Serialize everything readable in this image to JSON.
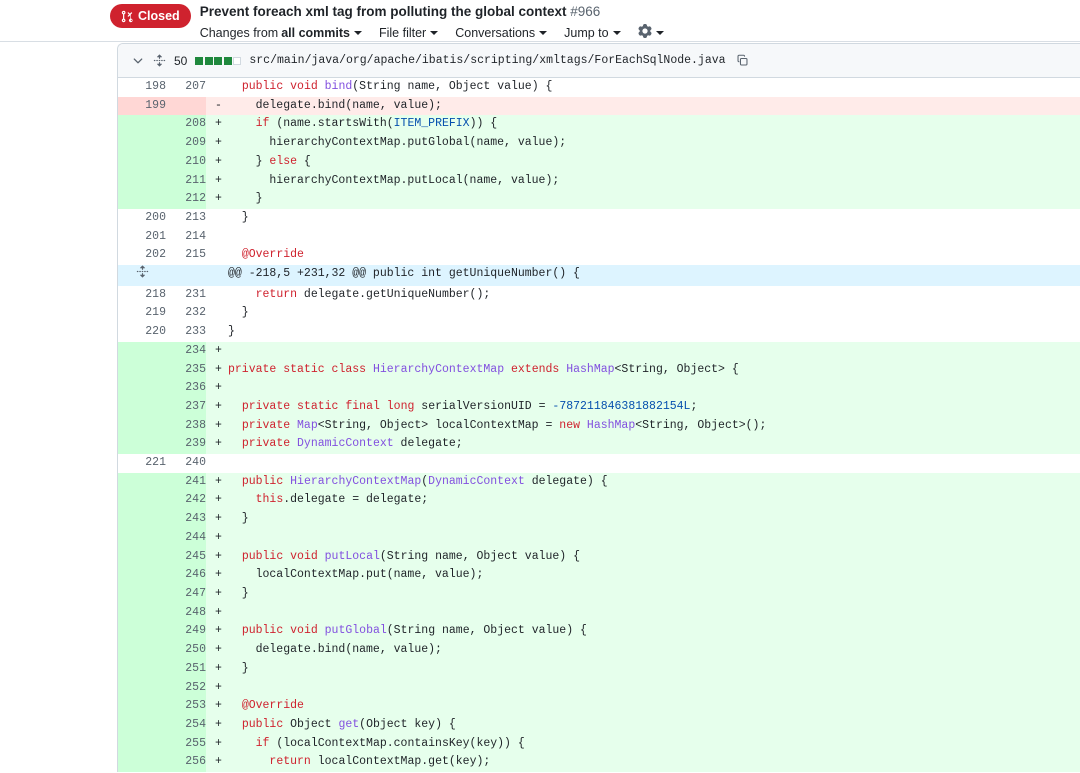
{
  "header": {
    "state_badge": {
      "label": "Closed",
      "icon": "pull-request-closed-icon",
      "color": "#cf222e"
    },
    "title": "Prevent foreach xml tag from polluting the global context",
    "number": "#966",
    "nav": [
      {
        "name": "changes-from",
        "prefix": "Changes from ",
        "strong": "all commits",
        "has_caret": true
      },
      {
        "name": "file-filter",
        "prefix": "",
        "strong": "File filter",
        "has_caret": true
      },
      {
        "name": "conversations",
        "prefix": "",
        "strong": "Conversations",
        "has_caret": true
      },
      {
        "name": "jump-to",
        "prefix": "",
        "strong": "Jump to",
        "has_caret": true
      }
    ],
    "settings_icon": "gear-icon"
  },
  "file": {
    "collapse_icon": "chevron-down-icon",
    "unfold_icon": "unfold-icon",
    "changes_count": "50",
    "diffstat": [
      "add",
      "add",
      "add",
      "add",
      "none"
    ],
    "path": "src/main/java/org/apache/ibatis/scripting/xmltags/ForEachSqlNode.java",
    "copy_icon": "copy-icon"
  },
  "colors": {
    "addition_bg": "#e6ffec",
    "addition_gutter": "#ccffd8",
    "deletion_bg": "#ffebe9",
    "deletion_gutter": "#ffd7d5",
    "hunk_bg": "#ddf4ff",
    "keyword": "#cf222e",
    "type": "#8250df",
    "constant": "#0550ae",
    "badge": "#cf222e"
  },
  "diff_lines": [
    {
      "type": "ctx",
      "old": "198",
      "new": "207",
      "marker": "",
      "tokens": [
        {
          "t": "  ",
          "c": "pl"
        },
        {
          "t": "public",
          "c": "k"
        },
        {
          "t": " ",
          "c": "pl"
        },
        {
          "t": "void",
          "c": "k"
        },
        {
          "t": " ",
          "c": "pl"
        },
        {
          "t": "bind",
          "c": "t"
        },
        {
          "t": "(String name, Object value) {",
          "c": "pl"
        }
      ]
    },
    {
      "type": "del",
      "old": "199",
      "new": "",
      "marker": "-",
      "tokens": [
        {
          "t": "    delegate.bind(name, value);",
          "c": "pl"
        }
      ]
    },
    {
      "type": "add",
      "old": "",
      "new": "208",
      "marker": "+",
      "tokens": [
        {
          "t": "    ",
          "c": "pl"
        },
        {
          "t": "if",
          "c": "k"
        },
        {
          "t": " (name.startsWith(",
          "c": "pl"
        },
        {
          "t": "ITEM_PREFIX",
          "c": "c"
        },
        {
          "t": ")) {",
          "c": "pl"
        }
      ]
    },
    {
      "type": "add",
      "old": "",
      "new": "209",
      "marker": "+",
      "tokens": [
        {
          "t": "      hierarchyContextMap.putGlobal(name, value);",
          "c": "pl"
        }
      ]
    },
    {
      "type": "add",
      "old": "",
      "new": "210",
      "marker": "+",
      "tokens": [
        {
          "t": "    } ",
          "c": "pl"
        },
        {
          "t": "else",
          "c": "k"
        },
        {
          "t": " {",
          "c": "pl"
        }
      ]
    },
    {
      "type": "add",
      "old": "",
      "new": "211",
      "marker": "+",
      "tokens": [
        {
          "t": "      hierarchyContextMap.putLocal(name, value);",
          "c": "pl"
        }
      ]
    },
    {
      "type": "add",
      "old": "",
      "new": "212",
      "marker": "+",
      "tokens": [
        {
          "t": "    }",
          "c": "pl"
        }
      ]
    },
    {
      "type": "ctx",
      "old": "200",
      "new": "213",
      "marker": "",
      "tokens": [
        {
          "t": "  }",
          "c": "pl"
        }
      ]
    },
    {
      "type": "ctx",
      "old": "201",
      "new": "214",
      "marker": "",
      "tokens": [
        {
          "t": "",
          "c": "pl"
        }
      ]
    },
    {
      "type": "ctx",
      "old": "202",
      "new": "215",
      "marker": "",
      "tokens": [
        {
          "t": "  ",
          "c": "pl"
        },
        {
          "t": "@Override",
          "c": "an"
        }
      ]
    },
    {
      "type": "hunk",
      "old": "",
      "new": "",
      "marker": "",
      "tokens": [
        {
          "t": "@@ -218,5 +231,32 @@ public int getUniqueNumber() {",
          "c": "pl"
        }
      ]
    },
    {
      "type": "ctx",
      "old": "218",
      "new": "231",
      "marker": "",
      "tokens": [
        {
          "t": "    ",
          "c": "pl"
        },
        {
          "t": "return",
          "c": "k"
        },
        {
          "t": " delegate.getUniqueNumber();",
          "c": "pl"
        }
      ]
    },
    {
      "type": "ctx",
      "old": "219",
      "new": "232",
      "marker": "",
      "tokens": [
        {
          "t": "  }",
          "c": "pl"
        }
      ]
    },
    {
      "type": "ctx",
      "old": "220",
      "new": "233",
      "marker": "",
      "tokens": [
        {
          "t": "}",
          "c": "pl"
        }
      ]
    },
    {
      "type": "add",
      "old": "",
      "new": "234",
      "marker": "+",
      "tokens": [
        {
          "t": "",
          "c": "pl"
        }
      ]
    },
    {
      "type": "add",
      "old": "",
      "new": "235",
      "marker": "+",
      "tokens": [
        {
          "t": "",
          "c": "pl"
        },
        {
          "t": "private",
          "c": "k"
        },
        {
          "t": " ",
          "c": "pl"
        },
        {
          "t": "static",
          "c": "k"
        },
        {
          "t": " ",
          "c": "pl"
        },
        {
          "t": "class",
          "c": "k"
        },
        {
          "t": " ",
          "c": "pl"
        },
        {
          "t": "HierarchyContextMap",
          "c": "t"
        },
        {
          "t": " ",
          "c": "pl"
        },
        {
          "t": "extends",
          "c": "k"
        },
        {
          "t": " ",
          "c": "pl"
        },
        {
          "t": "HashMap",
          "c": "t"
        },
        {
          "t": "<String, Object> {",
          "c": "pl"
        }
      ]
    },
    {
      "type": "add",
      "old": "",
      "new": "236",
      "marker": "+",
      "tokens": [
        {
          "t": "",
          "c": "pl"
        }
      ]
    },
    {
      "type": "add",
      "old": "",
      "new": "237",
      "marker": "+",
      "tokens": [
        {
          "t": "  ",
          "c": "pl"
        },
        {
          "t": "private",
          "c": "k"
        },
        {
          "t": " ",
          "c": "pl"
        },
        {
          "t": "static",
          "c": "k"
        },
        {
          "t": " ",
          "c": "pl"
        },
        {
          "t": "final",
          "c": "k"
        },
        {
          "t": " ",
          "c": "pl"
        },
        {
          "t": "long",
          "c": "k"
        },
        {
          "t": " serialVersionUID = ",
          "c": "pl"
        },
        {
          "t": "-787211846381882154L",
          "c": "c"
        },
        {
          "t": ";",
          "c": "pl"
        }
      ]
    },
    {
      "type": "add",
      "old": "",
      "new": "238",
      "marker": "+",
      "tokens": [
        {
          "t": "  ",
          "c": "pl"
        },
        {
          "t": "private",
          "c": "k"
        },
        {
          "t": " ",
          "c": "pl"
        },
        {
          "t": "Map",
          "c": "t"
        },
        {
          "t": "<String, Object> localContextMap = ",
          "c": "pl"
        },
        {
          "t": "new",
          "c": "k"
        },
        {
          "t": " ",
          "c": "pl"
        },
        {
          "t": "HashMap",
          "c": "t"
        },
        {
          "t": "<String, Object>();",
          "c": "pl"
        }
      ]
    },
    {
      "type": "add",
      "old": "",
      "new": "239",
      "marker": "+",
      "tokens": [
        {
          "t": "  ",
          "c": "pl"
        },
        {
          "t": "private",
          "c": "k"
        },
        {
          "t": " ",
          "c": "pl"
        },
        {
          "t": "DynamicContext",
          "c": "t"
        },
        {
          "t": " delegate;",
          "c": "pl"
        }
      ]
    },
    {
      "type": "ctx",
      "old": "221",
      "new": "240",
      "marker": "",
      "tokens": [
        {
          "t": "",
          "c": "pl"
        }
      ]
    },
    {
      "type": "add",
      "old": "",
      "new": "241",
      "marker": "+",
      "tokens": [
        {
          "t": "  ",
          "c": "pl"
        },
        {
          "t": "public",
          "c": "k"
        },
        {
          "t": " ",
          "c": "pl"
        },
        {
          "t": "HierarchyContextMap",
          "c": "t"
        },
        {
          "t": "(",
          "c": "pl"
        },
        {
          "t": "DynamicContext",
          "c": "t"
        },
        {
          "t": " delegate) {",
          "c": "pl"
        }
      ]
    },
    {
      "type": "add",
      "old": "",
      "new": "242",
      "marker": "+",
      "tokens": [
        {
          "t": "    ",
          "c": "pl"
        },
        {
          "t": "this",
          "c": "k"
        },
        {
          "t": ".delegate = delegate;",
          "c": "pl"
        }
      ]
    },
    {
      "type": "add",
      "old": "",
      "new": "243",
      "marker": "+",
      "tokens": [
        {
          "t": "  }",
          "c": "pl"
        }
      ]
    },
    {
      "type": "add",
      "old": "",
      "new": "244",
      "marker": "+",
      "tokens": [
        {
          "t": "",
          "c": "pl"
        }
      ]
    },
    {
      "type": "add",
      "old": "",
      "new": "245",
      "marker": "+",
      "tokens": [
        {
          "t": "  ",
          "c": "pl"
        },
        {
          "t": "public",
          "c": "k"
        },
        {
          "t": " ",
          "c": "pl"
        },
        {
          "t": "void",
          "c": "k"
        },
        {
          "t": " ",
          "c": "pl"
        },
        {
          "t": "putLocal",
          "c": "t"
        },
        {
          "t": "(String name, Object value) {",
          "c": "pl"
        }
      ]
    },
    {
      "type": "add",
      "old": "",
      "new": "246",
      "marker": "+",
      "tokens": [
        {
          "t": "    localContextMap.put(name, value);",
          "c": "pl"
        }
      ]
    },
    {
      "type": "add",
      "old": "",
      "new": "247",
      "marker": "+",
      "tokens": [
        {
          "t": "  }",
          "c": "pl"
        }
      ]
    },
    {
      "type": "add",
      "old": "",
      "new": "248",
      "marker": "+",
      "tokens": [
        {
          "t": "",
          "c": "pl"
        }
      ]
    },
    {
      "type": "add",
      "old": "",
      "new": "249",
      "marker": "+",
      "tokens": [
        {
          "t": "  ",
          "c": "pl"
        },
        {
          "t": "public",
          "c": "k"
        },
        {
          "t": " ",
          "c": "pl"
        },
        {
          "t": "void",
          "c": "k"
        },
        {
          "t": " ",
          "c": "pl"
        },
        {
          "t": "putGlobal",
          "c": "t"
        },
        {
          "t": "(String name, Object value) {",
          "c": "pl"
        }
      ]
    },
    {
      "type": "add",
      "old": "",
      "new": "250",
      "marker": "+",
      "tokens": [
        {
          "t": "    delegate.bind(name, value);",
          "c": "pl"
        }
      ]
    },
    {
      "type": "add",
      "old": "",
      "new": "251",
      "marker": "+",
      "tokens": [
        {
          "t": "  }",
          "c": "pl"
        }
      ]
    },
    {
      "type": "add",
      "old": "",
      "new": "252",
      "marker": "+",
      "tokens": [
        {
          "t": "",
          "c": "pl"
        }
      ]
    },
    {
      "type": "add",
      "old": "",
      "new": "253",
      "marker": "+",
      "tokens": [
        {
          "t": "  ",
          "c": "pl"
        },
        {
          "t": "@Override",
          "c": "an"
        }
      ]
    },
    {
      "type": "add",
      "old": "",
      "new": "254",
      "marker": "+",
      "tokens": [
        {
          "t": "  ",
          "c": "pl"
        },
        {
          "t": "public",
          "c": "k"
        },
        {
          "t": " Object ",
          "c": "pl"
        },
        {
          "t": "get",
          "c": "t"
        },
        {
          "t": "(Object key) {",
          "c": "pl"
        }
      ]
    },
    {
      "type": "add",
      "old": "",
      "new": "255",
      "marker": "+",
      "tokens": [
        {
          "t": "    ",
          "c": "pl"
        },
        {
          "t": "if",
          "c": "k"
        },
        {
          "t": " (localContextMap.containsKey(key)) {",
          "c": "pl"
        }
      ]
    },
    {
      "type": "add",
      "old": "",
      "new": "256",
      "marker": "+",
      "tokens": [
        {
          "t": "      ",
          "c": "pl"
        },
        {
          "t": "return",
          "c": "k"
        },
        {
          "t": " localContextMap.get(key);",
          "c": "pl"
        }
      ]
    }
  ]
}
